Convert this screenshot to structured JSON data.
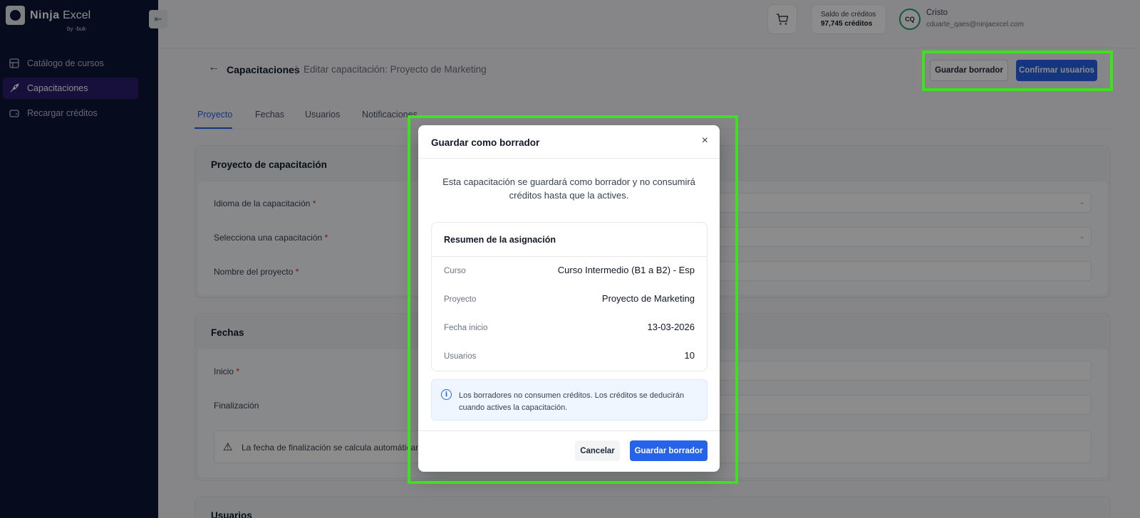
{
  "brand": {
    "name_bold": "Ninja",
    "name_light": "Excel",
    "byline": "by ·buk·"
  },
  "sidebar": {
    "items": [
      {
        "label": "Catálogo de cursos",
        "icon": "catalog-icon"
      },
      {
        "label": "Capacitaciones",
        "icon": "rocket-icon",
        "active": true
      },
      {
        "label": "Recargar créditos",
        "icon": "wallet-icon"
      }
    ]
  },
  "topbar": {
    "credits_label": "Saldo de créditos",
    "credits_value": "97,745 créditos",
    "avatar_initials": "CQ",
    "user_name": "Cristo",
    "user_email": "cduarte_qaes@ninjaexcel.com"
  },
  "header": {
    "title": "Capacitaciones",
    "separator": "|",
    "subtitle": "Editar capacitación: Proyecto de Marketing",
    "draft_button": "Guardar borrador",
    "confirm_button": "Confirmar usuarios"
  },
  "tabs": [
    "Proyecto",
    "Fechas",
    "Usuarios",
    "Notificaciones"
  ],
  "form": {
    "project_card_title": "Proyecto de capacitación",
    "language_label": "Idioma de la capacitación",
    "select_label": "Selecciona una capacitación",
    "name_label": "Nombre del proyecto",
    "dates_card_title": "Fechas",
    "start_label": "Inicio",
    "end_label": "Finalización",
    "end_warning": "La fecha de finalización se calcula automáticamente",
    "users_card_title": "Usuarios",
    "required_mark": "*"
  },
  "modal": {
    "title": "Guardar como borrador",
    "close": "×",
    "description": "Esta capacitación se guardará como borrador y no consumirá créditos hasta que la actives.",
    "summary_title": "Resumen de la asignación",
    "summary": [
      {
        "label": "Curso",
        "value": "Curso Intermedio (B1 a B2) - Esp"
      },
      {
        "label": "Proyecto",
        "value": "Proyecto de Marketing"
      },
      {
        "label": "Fecha inicio",
        "value": "13-03-2026"
      },
      {
        "label": "Usuarios",
        "value": "10"
      }
    ],
    "info": "Los borradores no consumen créditos. Los créditos se deducirán cuando actives la capacitación.",
    "cancel_button": "Cancelar",
    "save_button": "Guardar borrador"
  },
  "colors": {
    "primary": "#2563eb",
    "sidebar_bg": "#0b1437",
    "highlight": "#3fe020"
  }
}
